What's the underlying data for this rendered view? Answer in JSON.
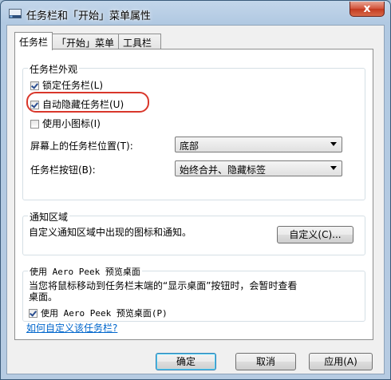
{
  "window": {
    "title": "任务栏和「开始」菜单属性",
    "close_glyph": "x"
  },
  "tabs": [
    {
      "label": "任务栏",
      "active": true
    },
    {
      "label": "「开始」菜单",
      "active": false
    },
    {
      "label": "工具栏",
      "active": false
    }
  ],
  "appearance": {
    "title": "任务栏外观",
    "lock": {
      "label": "锁定任务栏(L)",
      "checked": true
    },
    "autohide": {
      "label": "自动隐藏任务栏(U)",
      "checked": true
    },
    "small_icons": {
      "label": "使用小图标(I)",
      "checked": false
    },
    "location_label": "屏幕上的任务栏位置(T):",
    "location_value": "底部",
    "buttons_label": "任务栏按钮(B):",
    "buttons_value": "始终合并、隐藏标签"
  },
  "notification": {
    "title": "通知区域",
    "description": "自定义通知区域中出现的图标和通知。",
    "customize_button": "自定义(C)..."
  },
  "aero_peek": {
    "title": "使用 Aero Peek 预览桌面",
    "description_line1": "当您将鼠标移动到任务栏末端的“显示桌面”按钮时，会暂时查看",
    "description_line2": "桌面。",
    "checkbox": {
      "label": "使用 Aero Peek 预览桌面(P)",
      "checked": true
    }
  },
  "help_link": "如何自定义该任务栏?",
  "footer": {
    "ok": "确定",
    "cancel": "取消",
    "apply": "应用(A)"
  },
  "colors": {
    "highlight_ring": "#d9372b",
    "link": "#0066cc",
    "close_button": "#c33a20"
  },
  "icons": {
    "app": "taskbar-icon",
    "close": "close-icon",
    "dropdown": "chevron-down-icon"
  }
}
